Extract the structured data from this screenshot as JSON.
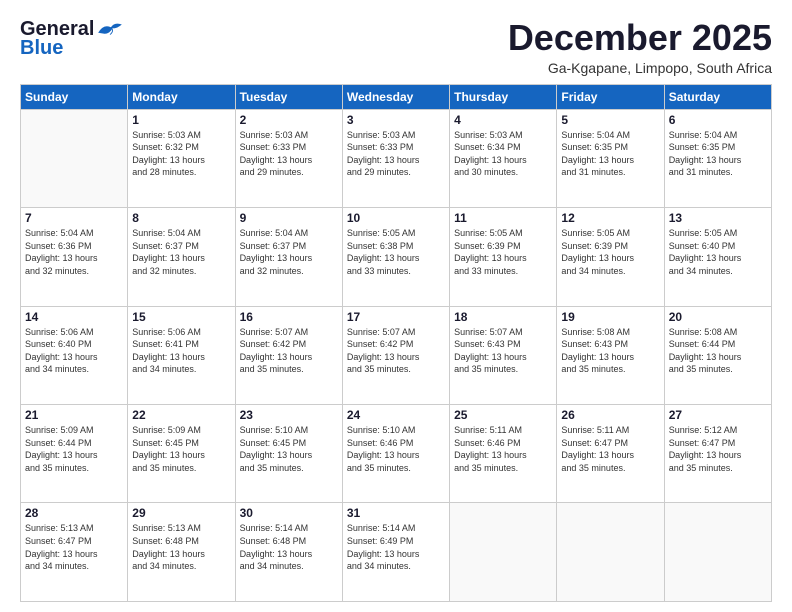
{
  "header": {
    "logo_general": "General",
    "logo_blue": "Blue",
    "month": "December 2025",
    "location": "Ga-Kgapane, Limpopo, South Africa"
  },
  "weekdays": [
    "Sunday",
    "Monday",
    "Tuesday",
    "Wednesday",
    "Thursday",
    "Friday",
    "Saturday"
  ],
  "weeks": [
    [
      {
        "day": "",
        "info": ""
      },
      {
        "day": "1",
        "info": "Sunrise: 5:03 AM\nSunset: 6:32 PM\nDaylight: 13 hours\nand 28 minutes."
      },
      {
        "day": "2",
        "info": "Sunrise: 5:03 AM\nSunset: 6:33 PM\nDaylight: 13 hours\nand 29 minutes."
      },
      {
        "day": "3",
        "info": "Sunrise: 5:03 AM\nSunset: 6:33 PM\nDaylight: 13 hours\nand 29 minutes."
      },
      {
        "day": "4",
        "info": "Sunrise: 5:03 AM\nSunset: 6:34 PM\nDaylight: 13 hours\nand 30 minutes."
      },
      {
        "day": "5",
        "info": "Sunrise: 5:04 AM\nSunset: 6:35 PM\nDaylight: 13 hours\nand 31 minutes."
      },
      {
        "day": "6",
        "info": "Sunrise: 5:04 AM\nSunset: 6:35 PM\nDaylight: 13 hours\nand 31 minutes."
      }
    ],
    [
      {
        "day": "7",
        "info": "Sunrise: 5:04 AM\nSunset: 6:36 PM\nDaylight: 13 hours\nand 32 minutes."
      },
      {
        "day": "8",
        "info": "Sunrise: 5:04 AM\nSunset: 6:37 PM\nDaylight: 13 hours\nand 32 minutes."
      },
      {
        "day": "9",
        "info": "Sunrise: 5:04 AM\nSunset: 6:37 PM\nDaylight: 13 hours\nand 32 minutes."
      },
      {
        "day": "10",
        "info": "Sunrise: 5:05 AM\nSunset: 6:38 PM\nDaylight: 13 hours\nand 33 minutes."
      },
      {
        "day": "11",
        "info": "Sunrise: 5:05 AM\nSunset: 6:39 PM\nDaylight: 13 hours\nand 33 minutes."
      },
      {
        "day": "12",
        "info": "Sunrise: 5:05 AM\nSunset: 6:39 PM\nDaylight: 13 hours\nand 34 minutes."
      },
      {
        "day": "13",
        "info": "Sunrise: 5:05 AM\nSunset: 6:40 PM\nDaylight: 13 hours\nand 34 minutes."
      }
    ],
    [
      {
        "day": "14",
        "info": "Sunrise: 5:06 AM\nSunset: 6:40 PM\nDaylight: 13 hours\nand 34 minutes."
      },
      {
        "day": "15",
        "info": "Sunrise: 5:06 AM\nSunset: 6:41 PM\nDaylight: 13 hours\nand 34 minutes."
      },
      {
        "day": "16",
        "info": "Sunrise: 5:07 AM\nSunset: 6:42 PM\nDaylight: 13 hours\nand 35 minutes."
      },
      {
        "day": "17",
        "info": "Sunrise: 5:07 AM\nSunset: 6:42 PM\nDaylight: 13 hours\nand 35 minutes."
      },
      {
        "day": "18",
        "info": "Sunrise: 5:07 AM\nSunset: 6:43 PM\nDaylight: 13 hours\nand 35 minutes."
      },
      {
        "day": "19",
        "info": "Sunrise: 5:08 AM\nSunset: 6:43 PM\nDaylight: 13 hours\nand 35 minutes."
      },
      {
        "day": "20",
        "info": "Sunrise: 5:08 AM\nSunset: 6:44 PM\nDaylight: 13 hours\nand 35 minutes."
      }
    ],
    [
      {
        "day": "21",
        "info": "Sunrise: 5:09 AM\nSunset: 6:44 PM\nDaylight: 13 hours\nand 35 minutes."
      },
      {
        "day": "22",
        "info": "Sunrise: 5:09 AM\nSunset: 6:45 PM\nDaylight: 13 hours\nand 35 minutes."
      },
      {
        "day": "23",
        "info": "Sunrise: 5:10 AM\nSunset: 6:45 PM\nDaylight: 13 hours\nand 35 minutes."
      },
      {
        "day": "24",
        "info": "Sunrise: 5:10 AM\nSunset: 6:46 PM\nDaylight: 13 hours\nand 35 minutes."
      },
      {
        "day": "25",
        "info": "Sunrise: 5:11 AM\nSunset: 6:46 PM\nDaylight: 13 hours\nand 35 minutes."
      },
      {
        "day": "26",
        "info": "Sunrise: 5:11 AM\nSunset: 6:47 PM\nDaylight: 13 hours\nand 35 minutes."
      },
      {
        "day": "27",
        "info": "Sunrise: 5:12 AM\nSunset: 6:47 PM\nDaylight: 13 hours\nand 35 minutes."
      }
    ],
    [
      {
        "day": "28",
        "info": "Sunrise: 5:13 AM\nSunset: 6:47 PM\nDaylight: 13 hours\nand 34 minutes."
      },
      {
        "day": "29",
        "info": "Sunrise: 5:13 AM\nSunset: 6:48 PM\nDaylight: 13 hours\nand 34 minutes."
      },
      {
        "day": "30",
        "info": "Sunrise: 5:14 AM\nSunset: 6:48 PM\nDaylight: 13 hours\nand 34 minutes."
      },
      {
        "day": "31",
        "info": "Sunrise: 5:14 AM\nSunset: 6:49 PM\nDaylight: 13 hours\nand 34 minutes."
      },
      {
        "day": "",
        "info": ""
      },
      {
        "day": "",
        "info": ""
      },
      {
        "day": "",
        "info": ""
      }
    ]
  ]
}
